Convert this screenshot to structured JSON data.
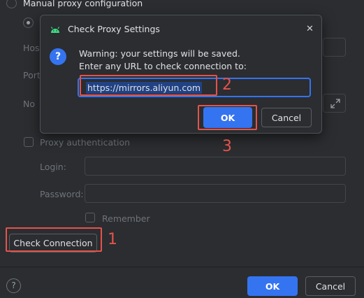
{
  "background": {
    "manual_proxy_label": "Manual proxy configuration",
    "host_label": "Hos",
    "port_label": "Port",
    "no_proxy_label": "No",
    "proxy_auth_label": "Proxy authentication",
    "login_label": "Login:",
    "password_label": "Password:",
    "remember_label": "Remember",
    "check_connection_label": "Check Connection",
    "ok_label": "OK",
    "cancel_label": "Cancel",
    "help_icon_glyph": "?"
  },
  "dialog": {
    "title": "Check Proxy Settings",
    "warning_line1": "Warning: your settings will be saved.",
    "warning_line2": "Enter any URL to check connection to:",
    "url_value": "https://mirrors.aliyun.com",
    "ok_label": "OK",
    "cancel_label": "Cancel",
    "close_glyph": "✕",
    "info_glyph": "?"
  },
  "annotations": {
    "n1": "1",
    "n2": "2",
    "n3": "3"
  },
  "colors": {
    "background": "#2b2d30",
    "accent": "#3574f0",
    "annotation": "#e5534b",
    "android_green": "#3ddc84"
  },
  "icons": [
    "radio-button",
    "android-icon",
    "info-icon",
    "close-icon",
    "expand-icon",
    "help-icon"
  ]
}
